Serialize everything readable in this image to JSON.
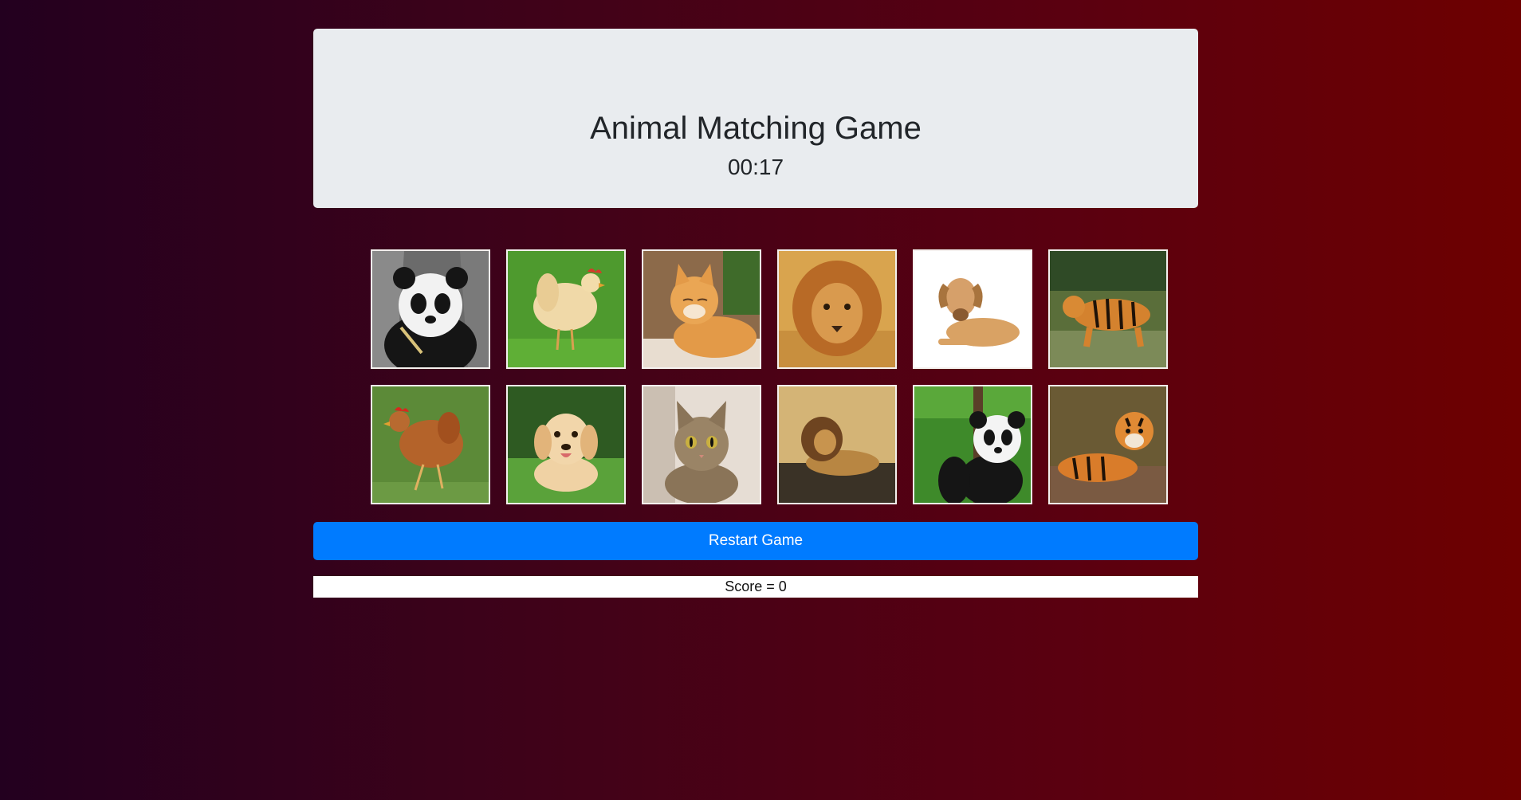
{
  "header": {
    "title": "Animal Matching Game",
    "timer": "00:17"
  },
  "board": {
    "cards": [
      {
        "animal": "panda",
        "icon": "panda-icon"
      },
      {
        "animal": "chicken",
        "icon": "chicken-icon"
      },
      {
        "animal": "cat",
        "icon": "cat-icon"
      },
      {
        "animal": "lion",
        "icon": "lion-icon"
      },
      {
        "animal": "dog",
        "icon": "dog-icon"
      },
      {
        "animal": "tiger",
        "icon": "tiger-icon"
      },
      {
        "animal": "chicken",
        "icon": "chicken-icon"
      },
      {
        "animal": "dog",
        "icon": "dog-icon"
      },
      {
        "animal": "cat",
        "icon": "cat-icon"
      },
      {
        "animal": "lion",
        "icon": "lion-icon"
      },
      {
        "animal": "panda",
        "icon": "panda-icon"
      },
      {
        "animal": "tiger",
        "icon": "tiger-icon"
      }
    ]
  },
  "controls": {
    "restart_label": "Restart Game"
  },
  "score": {
    "text": "Score = 0"
  },
  "colors": {
    "primary": "#007bff",
    "jumbotron": "#e9ecef",
    "background_left": "#23001f",
    "background_right": "#6e0000"
  }
}
